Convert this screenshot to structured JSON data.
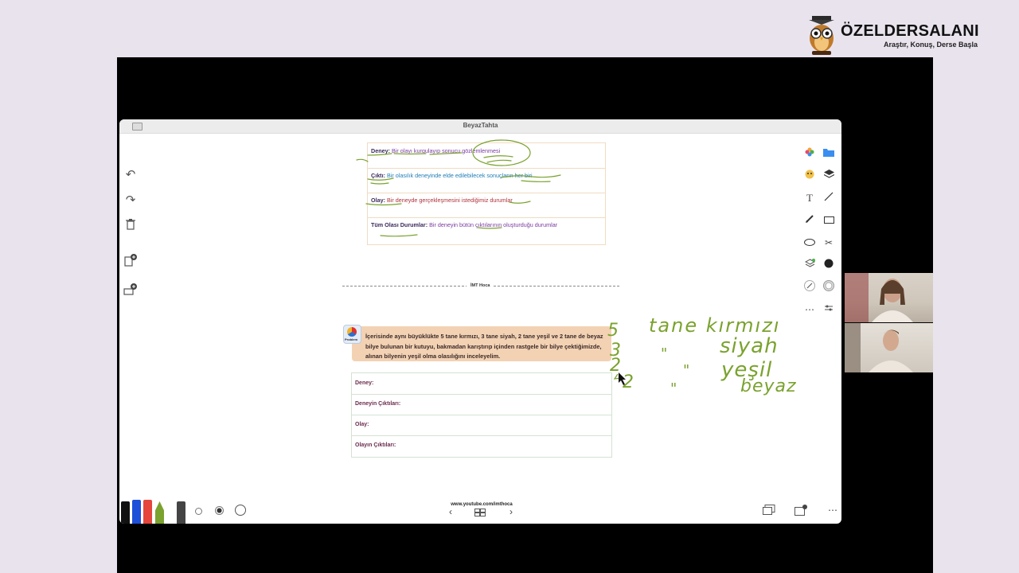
{
  "brand": {
    "name": "ÖZELDERSALANI",
    "tagline": "Araştır, Konuş, Derse Başla"
  },
  "window": {
    "title": "BeyazTahta"
  },
  "definitions": [
    {
      "label": "Deney:",
      "text": "Bir olayı kurgulayıp sonucu gözlemlenmesi",
      "color": "#7a3aa0"
    },
    {
      "label": "Çıktı:",
      "text": "Bir olasılık deneyinde elde edilebilecek sonuçların her biri",
      "color": "#1e7db5"
    },
    {
      "label": "Olay:",
      "text": "Bir deneyde gerçekleşmesini istediğimiz durumlar",
      "color": "#b0323a"
    },
    {
      "label": "Tüm Olası Durumlar:",
      "text": "Bir deneyin bütün çıktılarının oluşturduğu durumlar",
      "color": "#7a3aa0"
    }
  ],
  "separator": {
    "label": "İMT Hoca"
  },
  "question": {
    "badge": "Problem",
    "text": "İçerisinde aynı büyüklükte 5 tane kırmızı, 3 tane siyah, 2 tane yeşil ve 2 tane de beyaz bilye bulunan bir kutuyu, bakmadan karıştırıp içinden rastgele bir bilye çektiğimizde, alınan bilyenin yeşil olma olasılığını inceleyelim."
  },
  "answer_rows": [
    {
      "label": "Deney:"
    },
    {
      "label": "Deneyin Çıktıları:"
    },
    {
      "label": "Olay:"
    },
    {
      "label": "Olayın Çıktıları:"
    }
  ],
  "handwriting": {
    "numbers": [
      "5",
      "3",
      "2",
      "2"
    ],
    "words": [
      "tane kırmızı",
      "siyah",
      "yeşil",
      "beyaz"
    ],
    "ditto": "\""
  },
  "footer": {
    "url": "www.youtube.com/imthoca"
  },
  "left_tools": [
    "undo-icon",
    "redo-icon",
    "trash-icon",
    "add-page-icon",
    "add-board-icon"
  ],
  "right_tools": [
    "photos-icon",
    "folder-icon",
    "sticker-icon",
    "layers-icon",
    "text-icon",
    "line-icon",
    "pen-icon",
    "rectangle-icon",
    "ellipse-icon",
    "scissors-icon",
    "eraser-icon",
    "color-icon",
    "ruler-icon",
    "settings-icon",
    "more-icon",
    "adjust-icon"
  ],
  "colors": {
    "accent_green": "#7aa22e",
    "frame": "#000000",
    "background": "#e9e3ee"
  }
}
